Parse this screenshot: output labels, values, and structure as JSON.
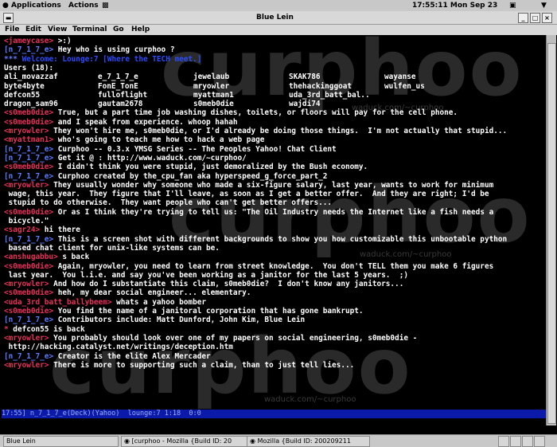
{
  "panel": {
    "applications": "Applications",
    "actions": "Actions",
    "clock": "17:55:11 Mon Sep 23"
  },
  "window": {
    "title": "Blue Lein"
  },
  "menu": [
    "File",
    "Edit",
    "View",
    "Terminal",
    "Go",
    "Help"
  ],
  "watermark": {
    "text": "curphoo",
    "url": "waduck.com/~curphoo"
  },
  "chat": [
    {
      "nick": "<jameycase>",
      "text": " >:)",
      "nc": "nick"
    },
    {
      "nick": "[n_7_1_7_e>",
      "text": " Hey who is using curphoo ?",
      "nc": "bnick"
    },
    {
      "nick": "*** ",
      "text": "",
      "nc": "bnick",
      "dimtext": "Welcome: Lounge:7 [Where the TECH meet.]"
    },
    {
      "nick": "",
      "text": "Users (18):",
      "nc": "nick"
    },
    {
      "users": true
    },
    {
      "users": true
    },
    {
      "users": true
    },
    {
      "users": true
    },
    {
      "nick": "<s0meb0die>",
      "text": " True, but a part time job washing dishes, toilets, or floors will pay for the cell phone.",
      "nc": "nick"
    },
    {
      "nick": "<s0meb0die>",
      "text": " and I speak from experience. whoop hahah",
      "nc": "nick"
    },
    {
      "nick": "<mryowler>",
      "text": " They won't hire me, s0meb0die, or I'd already be doing those things.  I'm not actually that stupid...",
      "nc": "nick"
    },
    {
      "nick": "<myattman1>",
      "text": " who's going to teach me how to hack a web page",
      "nc": "nick"
    },
    {
      "nick": "[n_7_1_7_e>",
      "text": " Curphoo -- 0.3.x YMSG Series -- The Peoples Yahoo! Chat Client",
      "nc": "bnick"
    },
    {
      "nick": "[n_7_1_7_e>",
      "text": " Get it @ : http://www.waduck.com/~curphoo/",
      "nc": "bnick"
    },
    {
      "nick": "<s0meb0die>",
      "text": " I didn't think you were stupid, just demoralized by the Bush economy.",
      "nc": "nick"
    },
    {
      "nick": "[n_7_1_7_e>",
      "text": " Curphoo created by the_cpu_fan aka hyperspeed_g_force_part_2",
      "nc": "bnick"
    },
    {
      "nick": "<mryowler>",
      "text": " They usually wonder why someone who made a six-figure salary, last year, wants to work for minimum",
      "nc": "nick"
    },
    {
      "nick": "",
      "text": " wage, this year.  They figure that I'll leave, as soon as I get a better offer.  And they are right; I'd be",
      "nc": "nick"
    },
    {
      "nick": "",
      "text": " stupid to do otherwise.  They want people who can't get better offers...",
      "nc": "nick"
    },
    {
      "nick": "<s0meb0die>",
      "text": " Or as I think they're trying to tell us: \"The Oil Industry needs the Internet like a fish needs a",
      "nc": "nick"
    },
    {
      "nick": "",
      "text": " bicycle.\"",
      "nc": "nick"
    },
    {
      "nick": "<sagr24>",
      "text": " hi there",
      "nc": "nick"
    },
    {
      "nick": "[n_7_1_7_e>",
      "text": " This is a screen shot with different backgrounds to show you how customizable this unbootable python",
      "nc": "bnick"
    },
    {
      "nick": "",
      "text": " based chat client for unix-like systems can be.",
      "nc": "nick"
    },
    {
      "nick": "<anshugabbu>",
      "text": " s back",
      "nc": "nick"
    },
    {
      "nick": "<s0meb0die>",
      "text": " Again, mryowler, you need to learn from street knowledge.  You don't TELL them you make 6 figures",
      "nc": "nick"
    },
    {
      "nick": "",
      "text": " last year.  You l.i.e. and say you've been working as a janitor for the last 5 years.  ;)",
      "nc": "nick"
    },
    {
      "nick": "<mryowler>",
      "text": " And how do I substantiate this claim, s0meb0die?  I don't know any janitors...",
      "nc": "nick"
    },
    {
      "nick": "<s0meb0die>",
      "text": " heh, my dear social engineer... elementary.",
      "nc": "nick"
    },
    {
      "nick": "<uda_3rd_batt_ballybeem>",
      "text": " whats a yahoo bomber",
      "nc": "nick"
    },
    {
      "nick": "<s0meb0die>",
      "text": " You find the name of a janitoral corporation that has gone bankrupt.",
      "nc": "nick"
    },
    {
      "nick": "[n_7_1_7_e>",
      "text": " Contributors include: Matt Dunford, John Kim, Blue Lein",
      "nc": "bnick"
    },
    {
      "nick": "* ",
      "text": "defcon55 is back",
      "nc": "nick"
    },
    {
      "nick": "<mryowler>",
      "text": " You probably should look over one of my papers on social engineering, s0meb0die -",
      "nc": "nick"
    },
    {
      "nick": "",
      "text": " http://hacking.catalyst.net/writings/deception.htm",
      "nc": "nick"
    },
    {
      "nick": "[n_7_1_7_e>",
      "text": " Creator is the elite Alex Mercader",
      "nc": "bnick"
    },
    {
      "nick": "<mryowler>",
      "text": " There is more to supporting such a claim, than to just tell lies...",
      "nc": "nick"
    }
  ],
  "users": [
    [
      "ali_movazzaf",
      "e_7_1_7_e",
      "jewelaub",
      "SKAK786",
      "wayanse"
    ],
    [
      "byte4byte",
      "FonE_TonE",
      "mryowler",
      "thehackinggoat",
      "wulfen_us"
    ],
    [
      "defcon55",
      "fulloflight",
      "myattman1",
      "uda_3rd_batt_bal..",
      ""
    ],
    [
      "dragon_sam96",
      "gautam2678",
      "s0meb0die",
      "wajdi74",
      ""
    ]
  ],
  "statusbar": "17:55] n_7_1_7_e(Deck)(Yahoo)  lounge:7 1:18  0:0",
  "taskbar": [
    "Blue Lein",
    "[curphoo - Mozilla {Build ID: 20",
    "Mozilla {Build ID: 200209211"
  ]
}
